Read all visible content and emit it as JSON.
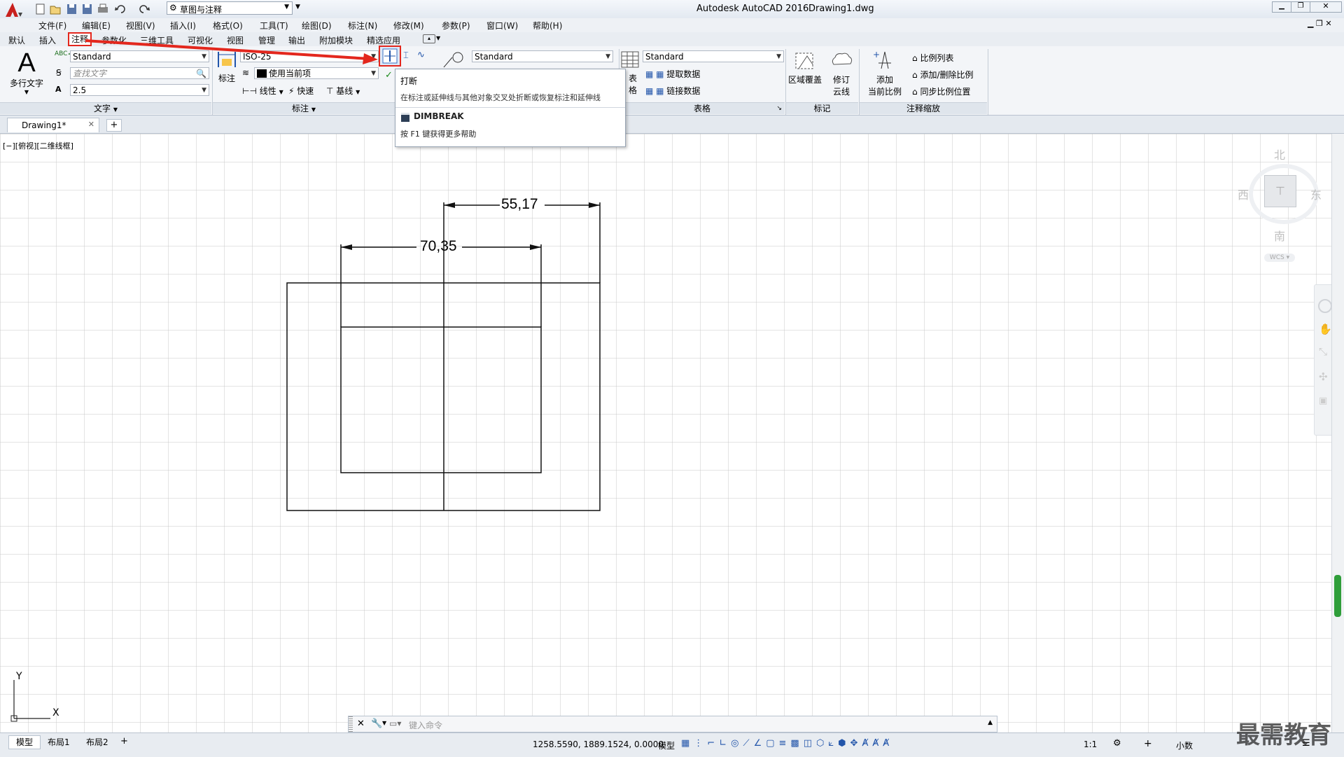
{
  "titlebar": {
    "app_title": "Autodesk AutoCAD 2016",
    "file_name": "Drawing1.dwg",
    "workspace": "草图与注释"
  },
  "menu": [
    "文件(F)",
    "编辑(E)",
    "视图(V)",
    "插入(I)",
    "格式(O)",
    "工具(T)",
    "绘图(D)",
    "标注(N)",
    "修改(M)",
    "参数(P)",
    "窗口(W)",
    "帮助(H)"
  ],
  "ribbon_tabs": [
    "默认",
    "插入",
    "注释",
    "参数化",
    "三维工具",
    "可视化",
    "视图",
    "管理",
    "输出",
    "附加模块",
    "精选应用"
  ],
  "ribbon": {
    "text_panel": {
      "mtext_label": "多行文字",
      "style": "Standard",
      "find_placeholder": "查找文字",
      "height": "2.5",
      "title": "文字"
    },
    "dim_panel": {
      "dim_label": "标注",
      "dim_style": "ISO-25",
      "layer": "使用当前项",
      "linear": "线性",
      "quick": "快速",
      "baseline": "基线",
      "title": "标注"
    },
    "leader_style": "Standard",
    "table_panel": {
      "table_label": "表格",
      "table_style": "Standard",
      "extract": "提取数据",
      "link": "链接数据",
      "title": "表格"
    },
    "markup_panel": {
      "wipeout": "区域覆盖",
      "revcloud_1": "修订",
      "revcloud_2": "云线",
      "title": "标记"
    },
    "scale_panel": {
      "add_1": "添加",
      "add_2": "当前比例",
      "scale_list": "比例列表",
      "add_delete": "添加/删除比例",
      "sync": "同步比例位置",
      "title": "注释缩放"
    }
  },
  "tooltip": {
    "title": "打断",
    "desc": "在标注或延伸线与其他对象交叉处折断或恢复标注和延伸线",
    "command": "DIMBREAK",
    "help": "按 F1 键获得更多帮助"
  },
  "doc_tab": "Drawing1*",
  "viewport_label": "[−][俯视][二维线框]",
  "viewcube": {
    "north": "北",
    "south": "南",
    "east": "东",
    "west": "西",
    "wcs": "WCS"
  },
  "drawing": {
    "dim_top": "55,17",
    "dim_inner": "70,35"
  },
  "ucs": {
    "y": "Y",
    "x": "X"
  },
  "command": {
    "placeholder": "键入命令"
  },
  "status": {
    "layout_tabs": [
      "模型",
      "布局1",
      "布局2"
    ],
    "coords": "1258.5590, 1889.1524, 0.0000",
    "model": "模型",
    "scale": "1:1",
    "units": "小数"
  },
  "watermark": "最需教育",
  "colors": {
    "accent_red": "#e3271d",
    "grid": "#c8c8c8"
  }
}
